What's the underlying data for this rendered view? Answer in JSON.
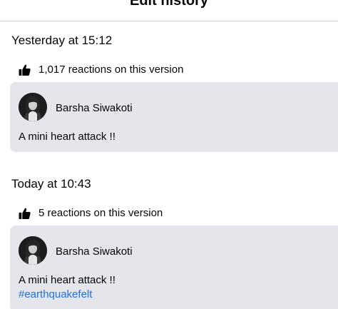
{
  "header": {
    "title": "Edit history"
  },
  "versions": [
    {
      "date": "Yesterday at 15:12",
      "reactions_text": "1,017 reactions on this version",
      "author": "Barsha Siwakoti",
      "text": "A mini heart attack !!"
    },
    {
      "date": "Today at 10:43",
      "reactions_text": "5 reactions on this version",
      "author": "Barsha Siwakoti",
      "text": "A mini heart attack !!",
      "hashtag": "#earthquakefelt"
    }
  ],
  "colors": {
    "card_background": "#e4e6eb",
    "hashtag": "#216fdb",
    "divider": "#ced0d4"
  },
  "icons": {
    "reactions": "thumbs-up-icon"
  }
}
